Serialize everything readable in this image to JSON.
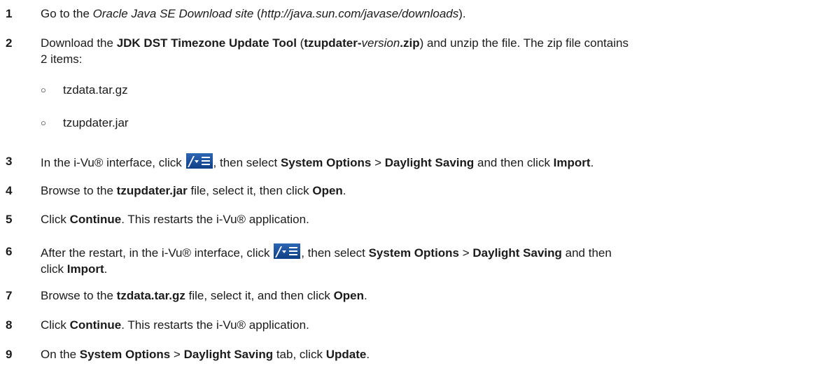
{
  "steps": [
    {
      "num": "1",
      "parts": [
        "Go to the ",
        "Oracle Java SE Download site",
        " (",
        "http://java.sun.com/javase/downloads",
        ")."
      ]
    },
    {
      "num": "2",
      "parts": [
        "Download the ",
        "JDK DST Timezone Update Tool",
        " (",
        "tzupdater-",
        "version",
        ".zip",
        ") and unzip the file.  The zip file contains",
        "2 items:"
      ]
    },
    {
      "num": "3",
      "parts": [
        "In the i-Vu® interface, click ",
        ", then select ",
        "System Options",
        " > ",
        "Daylight Saving",
        " and then click ",
        "Import",
        "."
      ]
    },
    {
      "num": "4",
      "parts": [
        "Browse to the ",
        "tzupdater.jar",
        " file, select it, then click ",
        "Open",
        "."
      ]
    },
    {
      "num": "5",
      "parts": [
        "Click ",
        "Continue",
        ".  This restarts the i-Vu® application."
      ]
    },
    {
      "num": "6",
      "parts": [
        "After the restart, in the i-Vu® interface, click ",
        ", then select ",
        "System Options",
        " > ",
        "Daylight Saving",
        " and then",
        "click ",
        "Import",
        "."
      ]
    },
    {
      "num": "7",
      "parts": [
        "Browse to the ",
        "tzdata.tar.gz",
        " file, select it, and then click ",
        "Open",
        "."
      ]
    },
    {
      "num": "8",
      "parts": [
        "Click ",
        "Continue",
        ".  This restarts the i-Vu® application."
      ]
    },
    {
      "num": "9",
      "parts": [
        "On the ",
        "System Options",
        " > ",
        "Daylight Saving",
        " tab, click ",
        "Update",
        "."
      ]
    }
  ],
  "zip_items": [
    {
      "bullet": "○",
      "label": "tzdata.tar.gz"
    },
    {
      "bullet": "○",
      "label": "tzupdater.jar"
    }
  ],
  "icons": {
    "menu": "menu-button-icon"
  }
}
